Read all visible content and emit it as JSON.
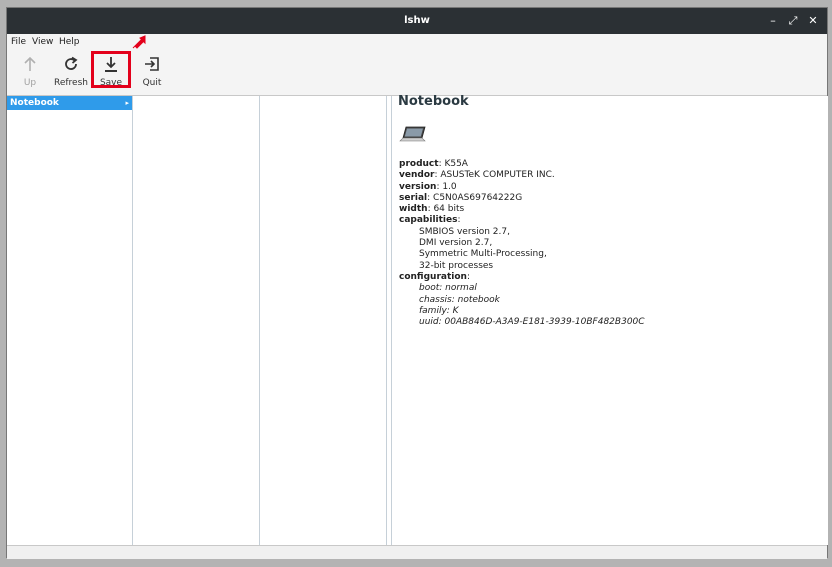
{
  "window": {
    "title": "lshw"
  },
  "window_controls": {
    "minimize": "–",
    "maximize": "⤢",
    "close": "✕"
  },
  "menu": {
    "file": "File",
    "view": "View",
    "help": "Help"
  },
  "toolbar": {
    "up_label": "Up",
    "refresh_label": "Refresh",
    "save_label": "Save",
    "quit_label": "Quit"
  },
  "tree": {
    "selected_label": "Notebook",
    "expander": "▸"
  },
  "details": {
    "heading": "Notebook",
    "product_key": "product",
    "product_value": ": K55A",
    "vendor_key": "vendor",
    "vendor_value": ": ASUSTeK COMPUTER INC.",
    "version_key": "version",
    "version_value": ": 1.0",
    "serial_key": "serial",
    "serial_value": ": C5N0AS69764222G",
    "width_key": "width",
    "width_value": ": 64 bits",
    "capabilities_key": "capabilities",
    "capabilities_colon": ":",
    "capabilities": [
      "SMBIOS version 2.7,",
      "DMI version 2.7,",
      "Symmetric Multi-Processing,",
      "32-bit processes"
    ],
    "configuration_key": "configuration",
    "configuration_colon": ":",
    "configuration": [
      "boot: normal",
      "chassis: notebook",
      "family: K",
      "uuid: 00AB846D-A3A9-E181-3939-10BF482B300C"
    ]
  },
  "colors": {
    "titlebar": "#2b3034",
    "selection": "#2f9bea",
    "highlight_box": "#e3001b"
  }
}
